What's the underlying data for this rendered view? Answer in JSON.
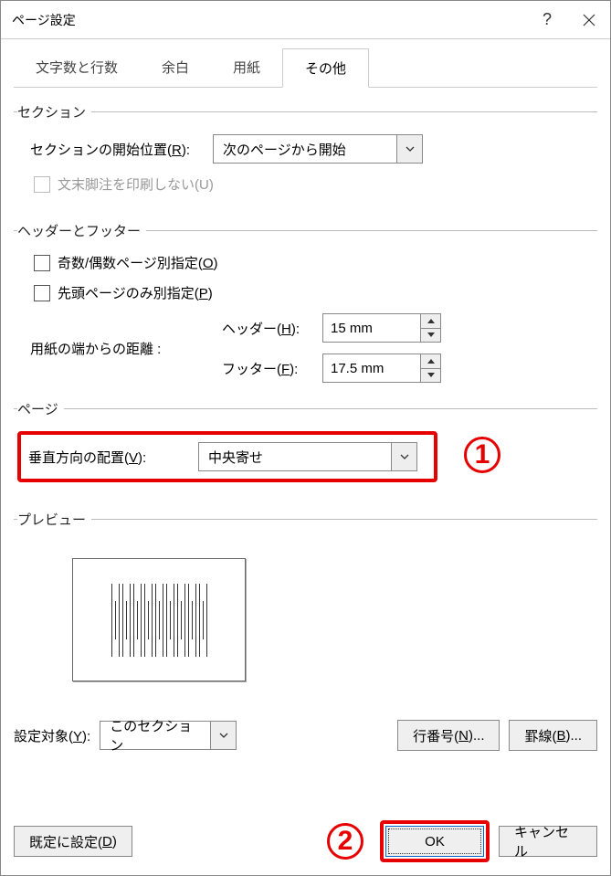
{
  "dialog": {
    "title": "ページ設定"
  },
  "tabs": {
    "t1": "文字数と行数",
    "t2": "余白",
    "t3": "用紙",
    "t4": "その他"
  },
  "section": {
    "legend": "セクション",
    "start_label": "セクションの開始位置(R):",
    "start_value": "次のページから開始",
    "endnote_label": "文末脚注を印刷しない(U)"
  },
  "headerfooter": {
    "legend": "ヘッダーとフッター",
    "odd_even": "奇数/偶数ページ別指定(O)",
    "first_page": "先頭ページのみ別指定(P)",
    "distance_label": "用紙の端からの距離 :",
    "header_label": "ヘッダー(H):",
    "header_value": "15 mm",
    "footer_label": "フッター(F):",
    "footer_value": "17.5 mm"
  },
  "page": {
    "legend": "ページ",
    "valign_label": "垂直方向の配置(V):",
    "valign_value": "中央寄せ"
  },
  "preview": {
    "legend": "プレビュー"
  },
  "apply": {
    "label": "設定対象(Y):",
    "value": "このセクション"
  },
  "buttons": {
    "linenum": "行番号(N)...",
    "border": "罫線(B)...",
    "default": "既定に設定(D)",
    "ok": "OK",
    "cancel": "キャンセル"
  },
  "markers": {
    "m1": "1",
    "m2": "2"
  }
}
